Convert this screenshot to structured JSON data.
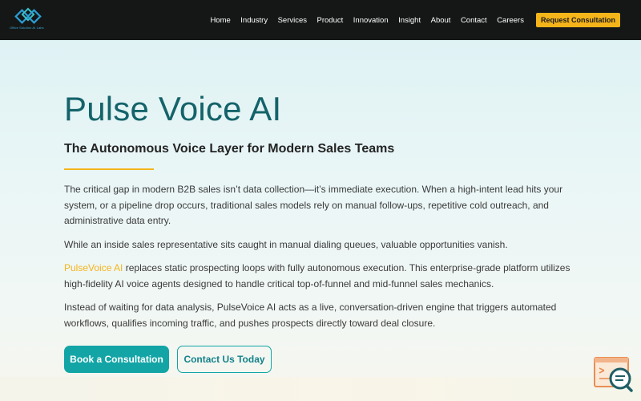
{
  "header": {
    "logo_tagline": "Office Solution AI Labs",
    "nav": [
      {
        "label": "Home"
      },
      {
        "label": "Industry"
      },
      {
        "label": "Services"
      },
      {
        "label": "Product"
      },
      {
        "label": "Innovation"
      },
      {
        "label": "Insight"
      },
      {
        "label": "About"
      },
      {
        "label": "Contact"
      },
      {
        "label": "Careers"
      }
    ],
    "cta_label": "Request Consultation"
  },
  "hero": {
    "title": "Pulse Voice AI",
    "subtitle": "The Autonomous Voice Layer for Modern Sales Teams",
    "p1": "The critical gap in modern B2B sales isn’t data collection—it’s immediate execution. When a high-intent lead hits your system, or a pipeline drop occurs, traditional sales models rely on manual follow-ups, repetitive cold outreach, and administrative data entry.",
    "p2": "While an inside sales representative sits caught in manual dialing queues, valuable opportunities vanish.",
    "p3_link": "PulseVoice AI",
    "p3_rest": " replaces static prospecting loops with fully autonomous execution. This enterprise-grade platform utilizes high-fidelity AI voice agents designed to handle critical top-of-funnel and mid-funnel sales mechanics.",
    "p4": "Instead of waiting for data analysis, PulseVoice AI acts as a live, conversation-driven engine that triggers automated workflows, qualifies incoming traffic, and pushes prospects directly toward deal closure.",
    "primary_button": "Book a Consultation",
    "secondary_button": "Contact Us Today"
  },
  "colors": {
    "header_bg": "#151717",
    "accent_yellow": "#f4b41a",
    "teal": "#13a5a6",
    "title_teal": "#14636a"
  },
  "icons": {
    "logo": "brand-logo",
    "chat": "chat-search-icon"
  }
}
